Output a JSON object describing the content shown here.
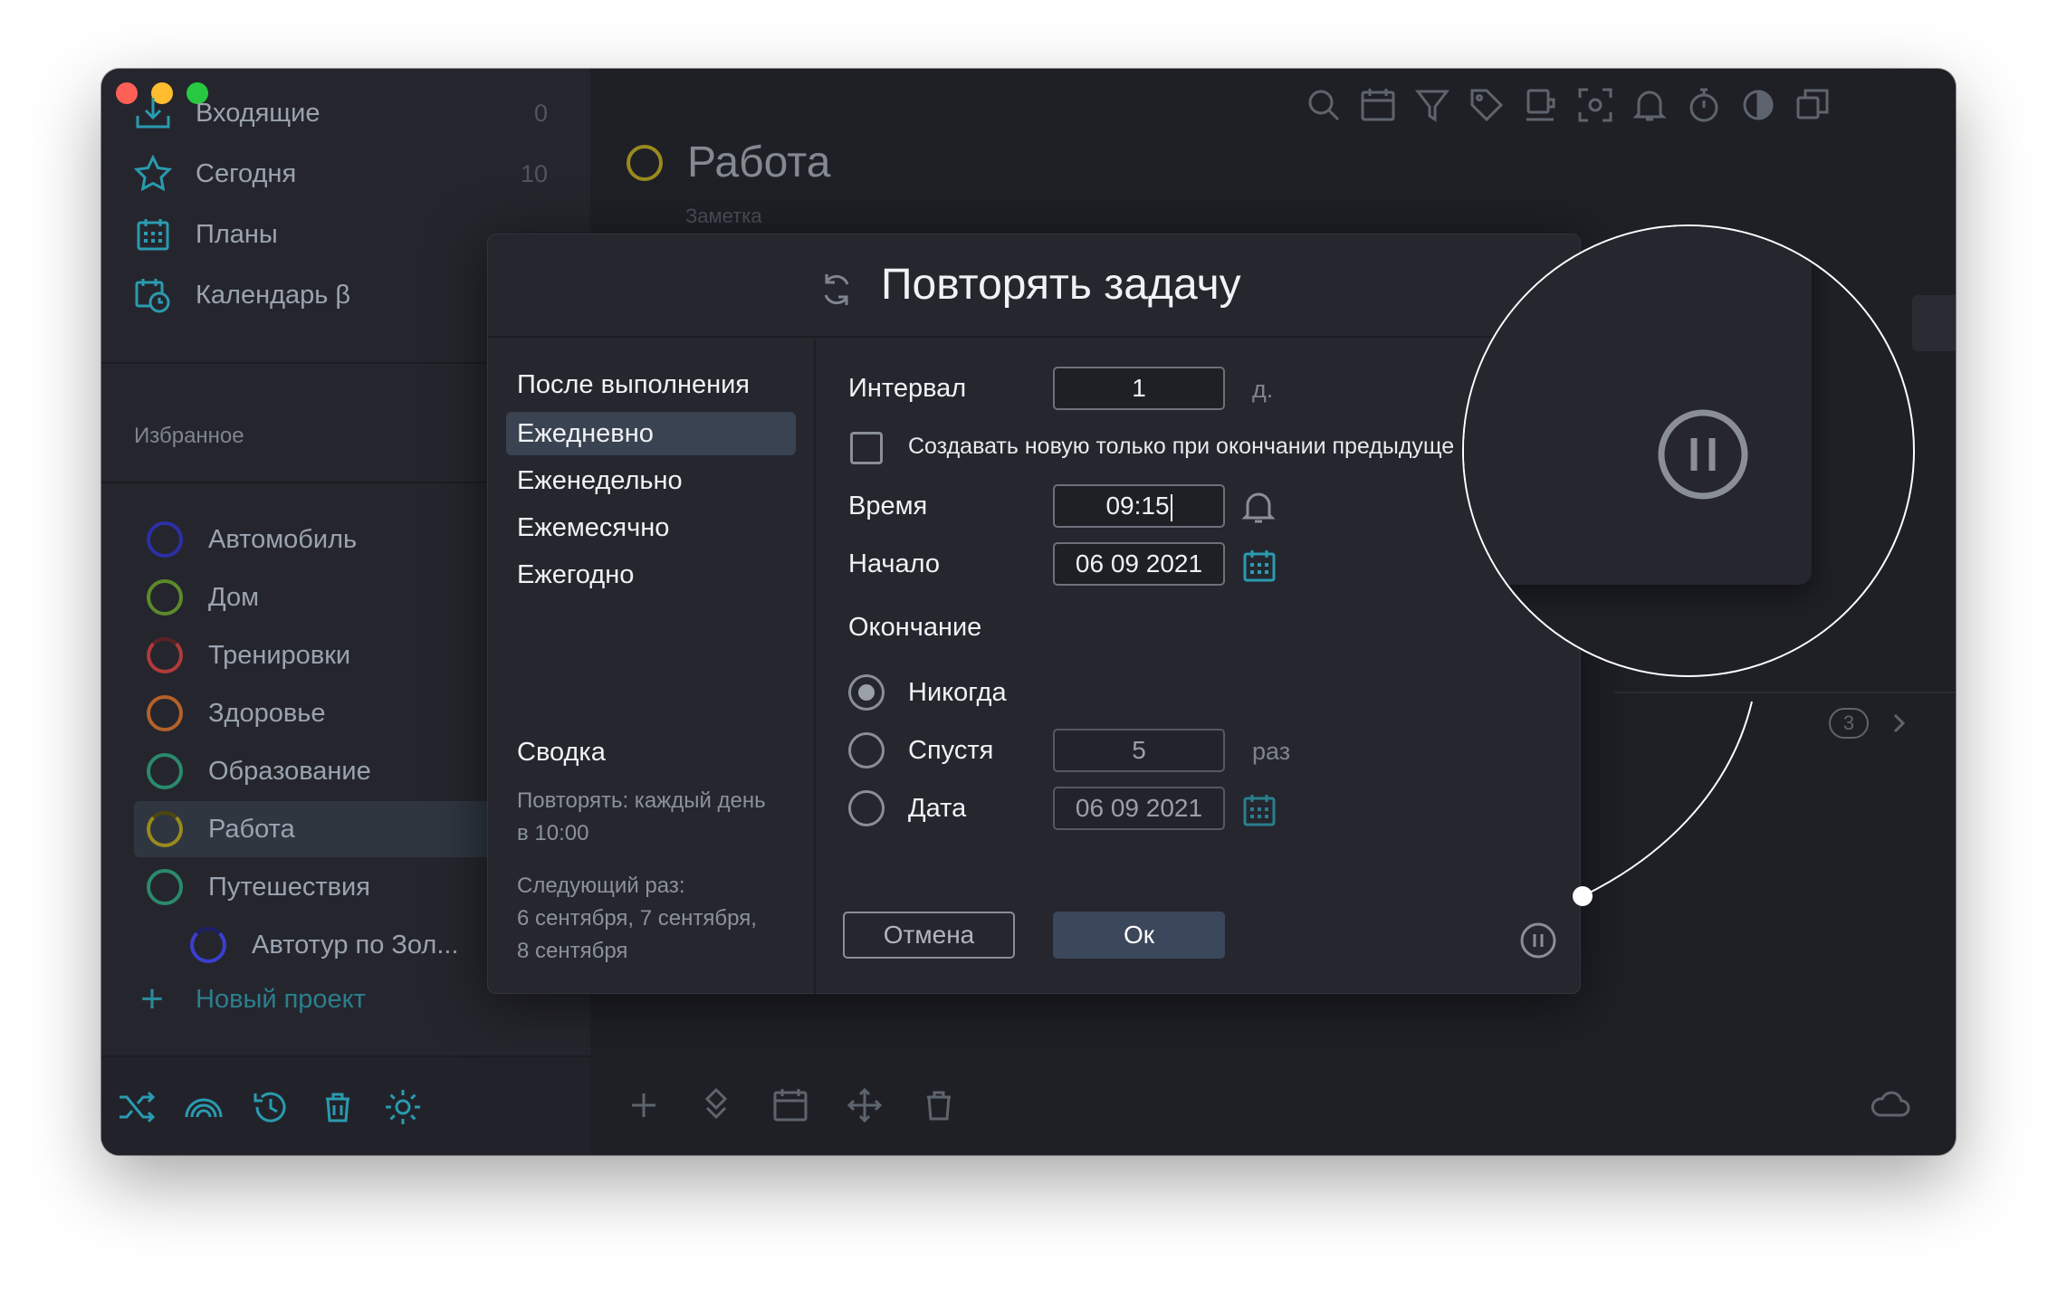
{
  "sidebar": {
    "nav": [
      {
        "label": "Входящие",
        "count": "0",
        "icon": "inbox-icon"
      },
      {
        "label": "Сегодня",
        "count": "10",
        "icon": "star-icon"
      },
      {
        "label": "Планы",
        "count": "",
        "icon": "calendar-grid-icon"
      },
      {
        "label": "Календарь β",
        "count": "",
        "icon": "calendar-clock-icon"
      }
    ],
    "favorites_title": "Избранное",
    "projects": [
      {
        "label": "Автомобиль",
        "color": "#2b2fa8"
      },
      {
        "label": "Дом",
        "color": "#5c8a2a"
      },
      {
        "label": "Тренировки",
        "color": "#b23a3a"
      },
      {
        "label": "Здоровье",
        "color": "#b5612a"
      },
      {
        "label": "Образование",
        "color": "#2a8a6c"
      },
      {
        "label": "Работа",
        "color": "#9a8a1d"
      },
      {
        "label": "Путешествия",
        "color": "#2a8a6c"
      },
      {
        "label": "Автотур по Зол...",
        "color": "#3a3fd0"
      }
    ],
    "new_project": "Новый проект"
  },
  "main": {
    "project_title": "Работа",
    "note_placeholder": "Заметка",
    "badge_count": "3"
  },
  "dialog": {
    "title": "Повторять задачу",
    "frequencies": [
      "После выполнения",
      "Ежедневно",
      "Еженедельно",
      "Ежемесячно",
      "Ежегодно"
    ],
    "selected_frequency": "Ежедневно",
    "interval_label": "Интервал",
    "interval_value": "1",
    "interval_unit": "д.",
    "checkbox_label": "Создавать новую только при окончании предыдуще",
    "time_label": "Время",
    "time_value": "09:15",
    "start_label": "Начало",
    "start_value": "06 09 2021",
    "end_label": "Окончание",
    "end_never": "Никогда",
    "end_after": "Спустя",
    "end_after_value": "5",
    "end_after_unit": "раз",
    "end_date": "Дата",
    "end_date_value": "06 09 2021",
    "summary_title": "Сводка",
    "summary_repeat_line1": "Повторять: каждый день",
    "summary_repeat_line2": "в 10:00",
    "summary_next_line1": "Следующий раз:",
    "summary_next_line2": "6 сентября, 7 сентября,",
    "summary_next_line3": "8 сентября",
    "cancel": "Отмена",
    "ok": "Ок"
  },
  "colors": {
    "accent": "#2a9bb0",
    "window_bg": "#202127"
  }
}
